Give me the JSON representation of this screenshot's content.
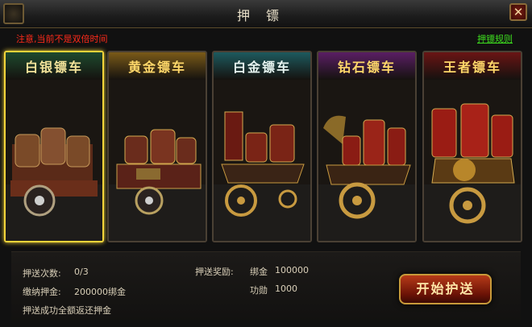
{
  "window": {
    "title": "押镖",
    "close_glyph": "✕"
  },
  "notice": "注意,当前不是双倍时间",
  "rules_link": "押镖规则",
  "carts": [
    {
      "name": "白银镖车",
      "selected": true,
      "header_color": "#1e4a2e",
      "name_color": "#f3e39a"
    },
    {
      "name": "黄金镖车",
      "selected": false,
      "header_color": "#7a5a18",
      "name_color": "#ffd86a"
    },
    {
      "name": "白金镖车",
      "selected": false,
      "header_color": "#1d5a5e",
      "name_color": "#e6f4f0"
    },
    {
      "name": "钻石镖车",
      "selected": false,
      "header_color": "#5a1e64",
      "name_color": "#ffd86a"
    },
    {
      "name": "王者镖车",
      "selected": false,
      "header_color": "#6a1414",
      "name_color": "#ffd86a"
    }
  ],
  "escort": {
    "count_label": "押送次数:",
    "count_value": "0/3",
    "deposit_label": "缴纳押金:",
    "deposit_value": "200000绑金",
    "refund_note": "押送成功全额返还押金",
    "reward_label": "押送奖励:",
    "rewards": [
      {
        "name": "绑金",
        "value": "100000"
      },
      {
        "name": "功勋",
        "value": "1000"
      }
    ]
  },
  "start_button": "开始护送"
}
